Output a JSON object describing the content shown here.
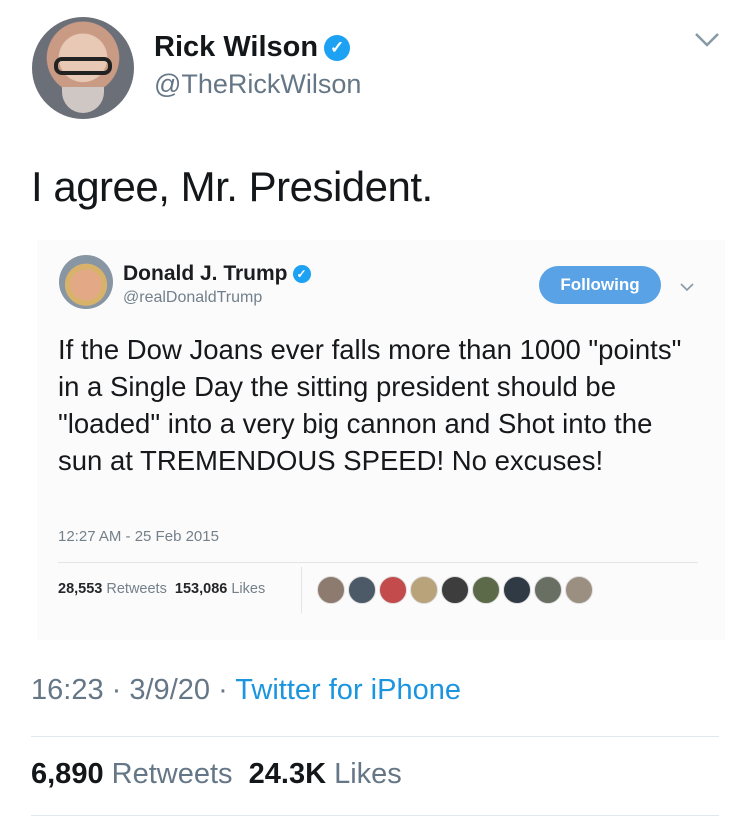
{
  "author": {
    "name": "Rick Wilson",
    "handle": "@TheRickWilson"
  },
  "tweet_text": "I agree, Mr. President.",
  "quoted_tweet": {
    "name": "Donald J. Trump",
    "handle": "@realDonaldTrump",
    "follow_label": "Following",
    "text": "If the Dow Joans ever falls more than 1000 \"points\" in a Single Day the sitting president should be \"loaded\" into a very big cannon and Shot into the sun at TREMENDOUS SPEED! No excuses!",
    "datetime": "12:27 AM - 25 Feb 2015",
    "retweets_count": "28,553",
    "retweets_label": "Retweets",
    "likes_count": "153,086",
    "likes_label": "Likes",
    "liker_colors": [
      "#8c7b6e",
      "#4b5a66",
      "#c44b4b",
      "#b9a37a",
      "#3d3d3d",
      "#5c6a4a",
      "#2f3a44",
      "#6a6f63",
      "#9a8f80"
    ]
  },
  "meta": {
    "time": "16:23",
    "date": "3/9/20",
    "source": "Twitter for iPhone",
    "dot": "·"
  },
  "stats": {
    "retweets_count": "6,890",
    "retweets_label": "Retweets",
    "likes_count": "24.3K",
    "likes_label": "Likes"
  },
  "colors": {
    "accent": "#1da1f2",
    "link": "#1b95e0",
    "muted": "#657786"
  }
}
